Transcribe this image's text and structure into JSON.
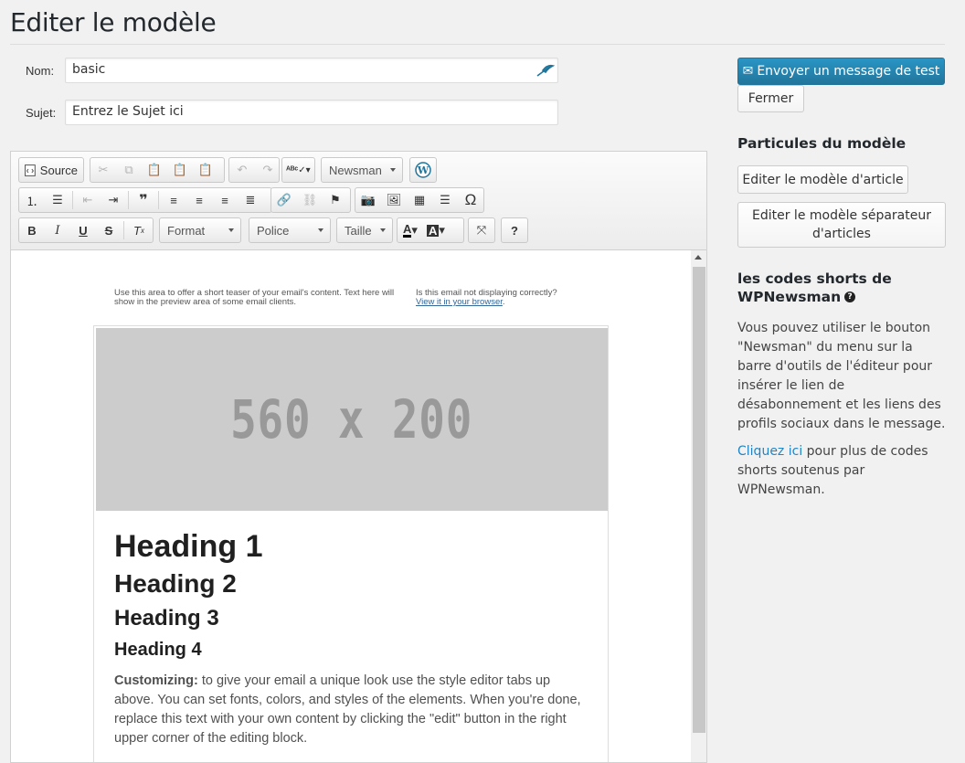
{
  "page": {
    "title": "Editer le modèle"
  },
  "form": {
    "name_label": "Nom:",
    "name_value": "basic",
    "subject_label": "Sujet:",
    "subject_placeholder": "Entrez le Sujet ici"
  },
  "toolbar": {
    "source_label": "Source",
    "newsman_label": "Newsman",
    "format_label": "Format",
    "font_label": "Police",
    "size_label": "Taille",
    "help_label": "?"
  },
  "email": {
    "preheader_left": "Use this area to offer a short teaser of your email's content. Text here will show in the preview area of some email clients.",
    "preheader_right_text": "Is this email not displaying correctly?",
    "preheader_right_link": "View it in your browser",
    "banner_text": "560 x 200",
    "heading1": "Heading 1",
    "heading2": "Heading 2",
    "heading3": "Heading 3",
    "heading4": "Heading 4",
    "para_bold": "Customizing:",
    "para_text": " to give your email a unique look use the style editor tabs up above. You can set fonts, colors, and styles of the elements. When you're done, replace this text with your own content by clicking the \"edit\" button in the right upper corner of the editing block."
  },
  "sidebar": {
    "send_test_label": "Envoyer un message de test",
    "close_label": "Fermer",
    "particles_title": "Particules du modèle",
    "edit_article_label": "Editer le modèle d'article",
    "edit_separator_label": "Editer le modèle séparateur d'articles",
    "shortcodes_title": "les codes shorts de WPNewsman",
    "shortcodes_text": "Vous pouvez utiliser le bouton \"Newsman\" du menu sur la barre d'outils de l'éditeur pour insérer le lien de désabonnement et les liens des profils sociaux dans le message.",
    "click_here_link": "Cliquez ici",
    "click_here_rest": " pour plus de codes shorts soutenus par WPNewsman."
  },
  "colors": {
    "primary": "#2185c5",
    "banner_bg": "#cccccc"
  }
}
